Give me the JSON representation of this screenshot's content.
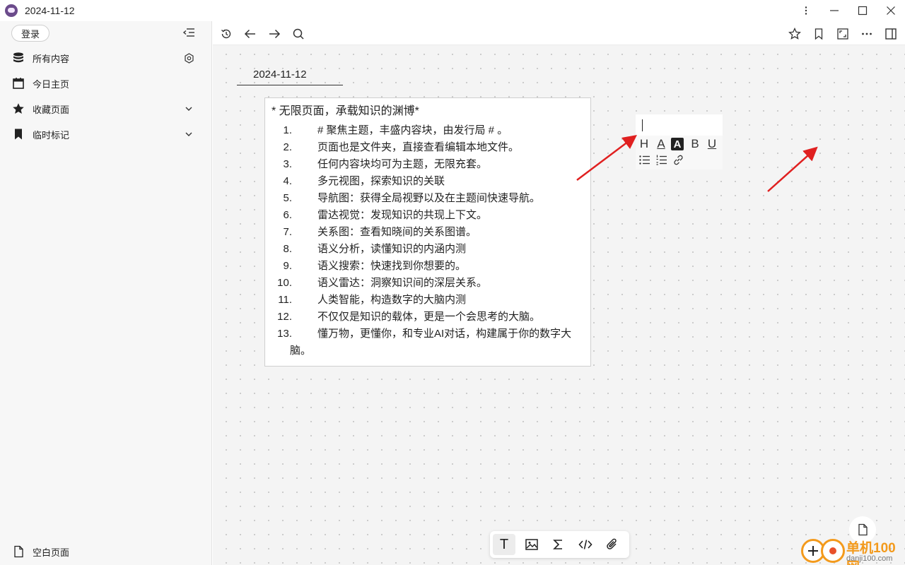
{
  "window": {
    "title": "2024-11-12",
    "controls": [
      "more-vertical-icon",
      "minimize-icon",
      "maximize-icon",
      "close-icon"
    ]
  },
  "sidebar": {
    "login_label": "登录",
    "items": [
      {
        "label": "所有内容",
        "icon": "database-icon",
        "trail": "settings-hex-icon"
      },
      {
        "label": "今日主页",
        "icon": "calendar-icon"
      },
      {
        "label": "收藏页面",
        "icon": "star-icon",
        "trail": "chevron-down-icon"
      },
      {
        "label": "临时标记",
        "icon": "bookmark-icon",
        "trail": "chevron-down-icon"
      }
    ],
    "blank_page_label": "空白页面"
  },
  "toolbar": {
    "left": [
      "history-icon",
      "back-arrow-icon",
      "forward-arrow-icon",
      "search-icon"
    ],
    "right": [
      "star-outline-icon",
      "bookmark-outline-icon",
      "fullscreen-icon",
      "more-horizontal-icon",
      "panel-toggle-icon"
    ]
  },
  "page": {
    "title": "2024-11-12"
  },
  "card": {
    "heading": "* 无限页面，承载知识的渊博*",
    "items": [
      {
        "num": "1.",
        "text": "# 聚焦主题，丰盛内容块，由发行局 # 。"
      },
      {
        "num": "2.",
        "text": "页面也是文件夹，直接查看编辑本地文件。"
      },
      {
        "num": "3.",
        "text": "任何内容块均可为主题，无限充套。"
      },
      {
        "num": "4.",
        "text": "多元视图，探索知识的关联"
      },
      {
        "num": "5.",
        "text": "导航图：获得全局视野以及在主题间快速导航。"
      },
      {
        "num": "6.",
        "text": "雷达视觉：发现知识的共现上下文。"
      },
      {
        "num": "7.",
        "text": "关系图：查看知晓间的关系图谱。"
      },
      {
        "num": "8.",
        "text": "语义分析，读懂知识的内涵内测"
      },
      {
        "num": "9.",
        "text": "语义搜索：快速找到你想要的。"
      },
      {
        "num": "10.",
        "text": "语义雷达：洞察知识间的深层关系。"
      },
      {
        "num": "11.",
        "text": "人类智能，构造数字的大脑内测"
      },
      {
        "num": "12.",
        "text": "不仅仅是知识的载体，更是一个会思考的大脑。"
      },
      {
        "num": "13.",
        "text": "懂万物，更懂你，和专业AI对话，构建属于你的数字大",
        "cont": "脑。"
      }
    ]
  },
  "format_toolbar": {
    "heading": "H",
    "text_color": "A",
    "highlight": "A",
    "bold": "B",
    "underline": "U"
  },
  "bottom_toolbar": {
    "text_label": "T",
    "tools": [
      "text-icon",
      "image-icon",
      "formula-icon",
      "code-icon",
      "attachment-icon"
    ]
  },
  "watermark": {
    "name": "单机100网",
    "domain": "danji100.com"
  },
  "colors": {
    "accent_arrow": "#e02020",
    "sidebar_bg": "#f7f7f7",
    "canvas_bg": "#f4f4f4",
    "watermark": "#f39a1c"
  }
}
